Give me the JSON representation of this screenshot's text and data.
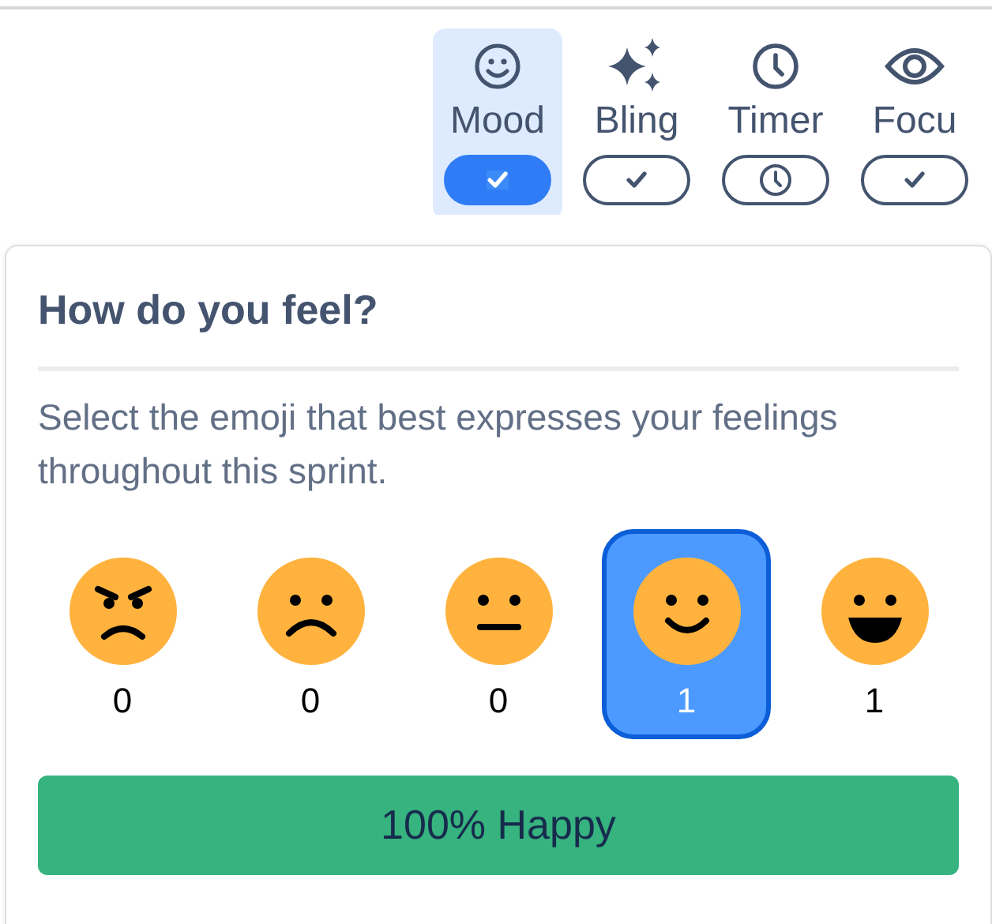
{
  "toolbar": [
    {
      "kind": "mood",
      "label": "Mood",
      "selected": true
    },
    {
      "kind": "bling",
      "label": "Bling",
      "selected": false
    },
    {
      "kind": "timer",
      "label": "Timer",
      "selected": false
    },
    {
      "kind": "focus",
      "label": "Focu",
      "selected": false
    }
  ],
  "popup": {
    "title": "How do you feel?",
    "description": "Select the emoji that best expresses your feelings throughout this sprint.",
    "options": [
      {
        "kind": "angry",
        "count": "0",
        "selected": false
      },
      {
        "kind": "sad",
        "count": "0",
        "selected": false
      },
      {
        "kind": "neutral",
        "count": "0",
        "selected": false
      },
      {
        "kind": "smile",
        "count": "1",
        "selected": true
      },
      {
        "kind": "grin",
        "count": "1",
        "selected": false
      }
    ],
    "result": "100% Happy"
  }
}
